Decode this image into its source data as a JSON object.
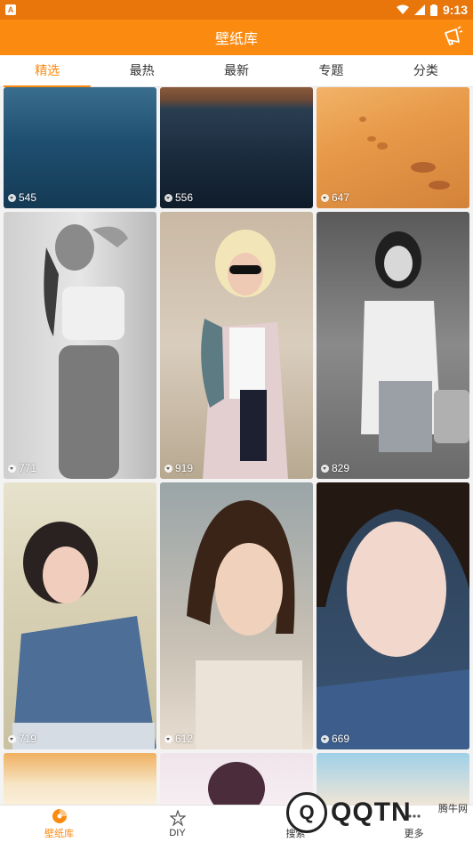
{
  "status_bar": {
    "time": "9:13",
    "notification_icon": "A"
  },
  "app_bar": {
    "title": "壁纸库"
  },
  "tabs": [
    {
      "label": "精选"
    },
    {
      "label": "最热"
    },
    {
      "label": "最新"
    },
    {
      "label": "专题"
    },
    {
      "label": "分类"
    }
  ],
  "tiles": [
    {
      "count": "545",
      "theme": "ocean"
    },
    {
      "count": "556",
      "theme": "lake"
    },
    {
      "count": "647",
      "theme": "desert"
    },
    {
      "count": "771",
      "theme": "bw-portrait"
    },
    {
      "count": "919",
      "theme": "sunglasses-portrait"
    },
    {
      "count": "829",
      "theme": "bw-street-portrait"
    },
    {
      "count": "719",
      "theme": "denim-portrait"
    },
    {
      "count": "612",
      "theme": "short-hair-portrait"
    },
    {
      "count": "669",
      "theme": "closeup-portrait"
    },
    {
      "theme": "anime"
    },
    {
      "theme": "anime"
    },
    {
      "theme": "anime"
    }
  ],
  "bottom_nav": [
    {
      "label": "壁纸库",
      "icon": "palette-icon"
    },
    {
      "label": "DIY",
      "icon": "star-icon"
    },
    {
      "label": "搜索",
      "icon": "search-icon"
    },
    {
      "label": "更多",
      "icon": "more-icon"
    }
  ],
  "watermark": {
    "text": "QQTN",
    "small": "腾牛网"
  },
  "colors": {
    "accent": "#fb8a10",
    "status": "#e8760a"
  }
}
